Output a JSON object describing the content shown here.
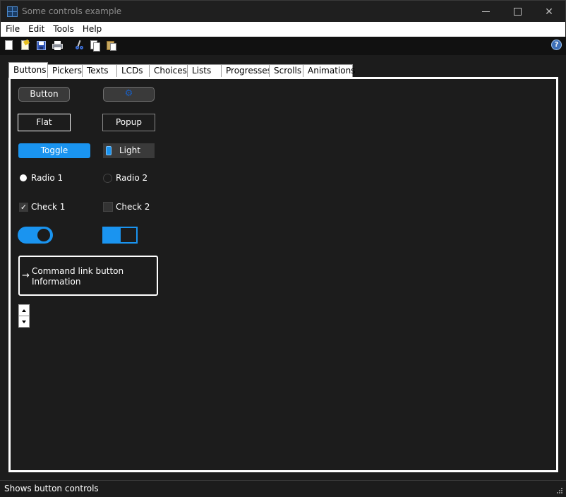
{
  "window": {
    "title": "Some controls example",
    "close_glyph": "✕"
  },
  "menu": {
    "items": [
      "File",
      "Edit",
      "Tools",
      "Help"
    ]
  },
  "toolbar": {
    "icons": [
      "new-document-icon",
      "open-icon",
      "save-icon",
      "print-icon",
      "cut-icon",
      "copy-icon",
      "paste-icon"
    ],
    "help_glyph": "?"
  },
  "tabs": [
    {
      "label": "Buttons",
      "active": true
    },
    {
      "label": "Pickers",
      "active": false
    },
    {
      "label": "Texts",
      "active": false
    },
    {
      "label": "LCDs",
      "active": false
    },
    {
      "label": "Choices",
      "active": false
    },
    {
      "label": "Lists",
      "active": false
    },
    {
      "label": "Progresses",
      "active": false
    },
    {
      "label": "Scrolls",
      "active": false
    },
    {
      "label": "Animations",
      "active": false
    }
  ],
  "controls": {
    "push_button": "Button",
    "icon_button_glyph": "⚙",
    "flat_button": "Flat",
    "popup_button": "Popup",
    "toggle_button": "Toggle",
    "light_button": "Light",
    "radio1": {
      "label": "Radio 1",
      "checked": true
    },
    "radio2": {
      "label": "Radio 2",
      "checked": false
    },
    "check1": {
      "label": "Check 1",
      "checked": true
    },
    "check2": {
      "label": "Check 2",
      "checked": false
    },
    "check_glyph": "✓",
    "switch1_on": true,
    "switch2_on": true,
    "command_link": {
      "arrow": "→",
      "title": "Command link button",
      "description": "Information"
    }
  },
  "colors": {
    "accent": "#1a94f0",
    "background": "#1c1c1c",
    "panel_border": "#ffffff"
  },
  "status": {
    "text": "Shows button controls"
  }
}
